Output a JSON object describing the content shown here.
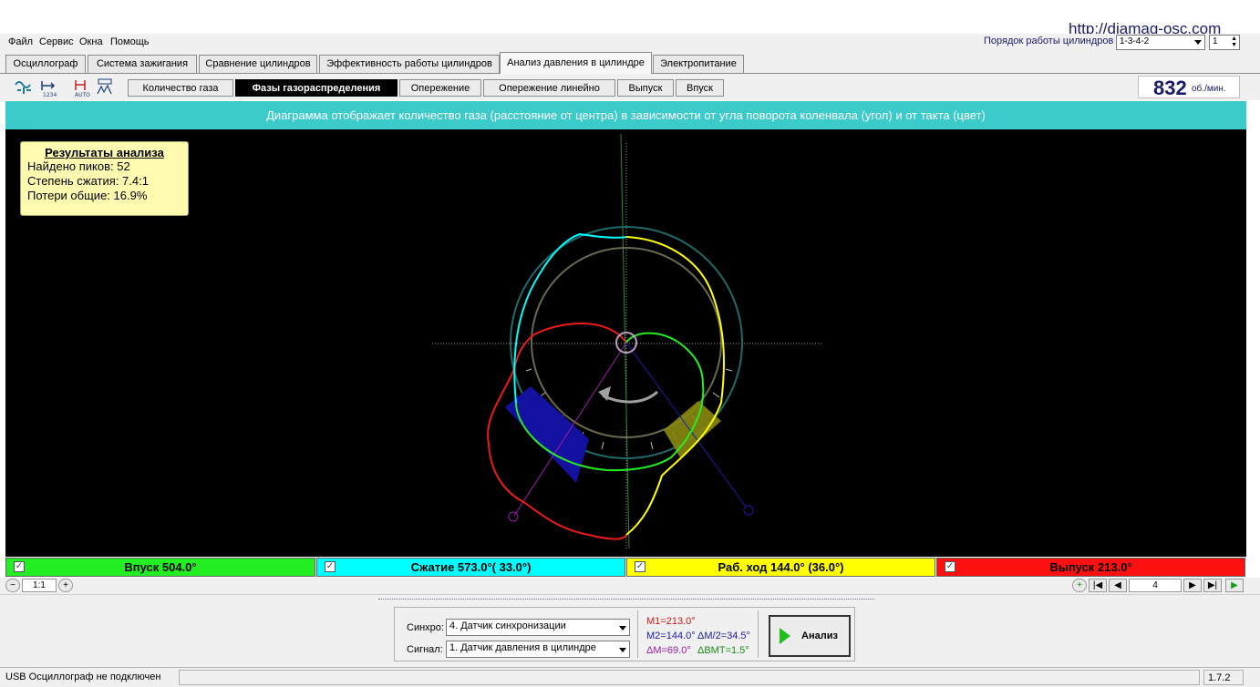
{
  "watermark": "http://diamag-osc.com",
  "menu": [
    "Файл",
    "Сервис",
    "Окна",
    "Помощь"
  ],
  "cylinder_order": {
    "label": "Порядок работы цилиндров",
    "value": "1-3-4-2",
    "cylinder": "1"
  },
  "top_tabs": [
    "Осциллограф",
    "Система зажигания",
    "Сравнение цилиндров",
    "Эффективность работы цилиндров",
    "Анализ давления в цилиндре",
    "Электропитание"
  ],
  "top_tab_active": "Анализ давления в цилиндре",
  "toolbar_icons": [
    "waveform-icon",
    "measure-1234-icon",
    "auto-marker-icon",
    "graph-icon"
  ],
  "sub_tabs": [
    "Количество газа",
    "Фазы газораспределения",
    "Опережение",
    "Опережение линейно",
    "Выпуск",
    "Впуск"
  ],
  "sub_tab_active": "Фазы газораспределения",
  "rpm": {
    "value": "832",
    "unit": "об./мин."
  },
  "info_banner": "Диаграмма отображает количество газа (расстояние от центра) в зависимости от угла поворота коленвала (угол) и от такта (цвет)",
  "results": {
    "title": "Результаты анализа",
    "peaks": "Найдено пиков: 52",
    "compression": "Степень сжатия: 7.4:1",
    "losses": "Потери общие: 16.9%"
  },
  "legend": [
    {
      "label": "Впуск 504.0°",
      "color": "#22ee22",
      "checked": true
    },
    {
      "label": "Сжатие 573.0°( 33.0°)",
      "color": "#00ffff",
      "checked": true
    },
    {
      "label": "Раб. ход 144.0° (36.0°)",
      "color": "#ffff00",
      "checked": true
    },
    {
      "label": "Выпуск 213.0°",
      "color": "#ff1010",
      "checked": true
    }
  ],
  "zoom": "1:1",
  "page_number": "4",
  "bottom": {
    "sync_label": "Синхро:",
    "sync_value": "4.  Датчик синхронизации",
    "signal_label": "Сигнал:",
    "signal_value": "1.  Датчик давления в цилиндре",
    "m1": "M1=213.0°",
    "m2": "M2=144.0°",
    "dm2": "ΔM/2=34.5°",
    "dm": "ΔM=69.0°",
    "dbmt": "ΔВМТ=1.5°",
    "analyze_label": "Анализ"
  },
  "status": {
    "left": "USB Осциллограф не подключен",
    "version": "1.7.2"
  }
}
